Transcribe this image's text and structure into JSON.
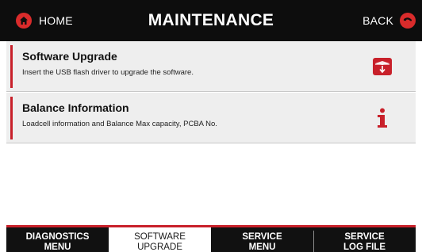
{
  "header": {
    "title": "MAINTENANCE",
    "home_label": "HOME",
    "back_label": "BACK",
    "home_icon": "home-icon",
    "back_icon": "back-arrow-icon"
  },
  "items": [
    {
      "title": "Software Upgrade",
      "description": "Insert the USB flash driver to upgrade the software.",
      "icon": "box-download-icon"
    },
    {
      "title": "Balance Information",
      "description": "Loadcell information and Balance Max capacity, PCBA No.",
      "icon": "info-icon"
    }
  ],
  "tabs": [
    {
      "line1": "DIAGNOSTICS",
      "line2": "MENU",
      "active": false
    },
    {
      "line1": "SOFTWARE",
      "line2": "UPGRADE",
      "active": true
    },
    {
      "line1": "SERVICE",
      "line2": "MENU",
      "active": false
    },
    {
      "line1": "SERVICE",
      "line2": "LOG FILE",
      "active": false
    }
  ],
  "colors": {
    "accent": "#c8202a",
    "header_bg": "#0d0d0d",
    "item_bg": "#eeeeee",
    "icon_red": "#d92b2b"
  }
}
